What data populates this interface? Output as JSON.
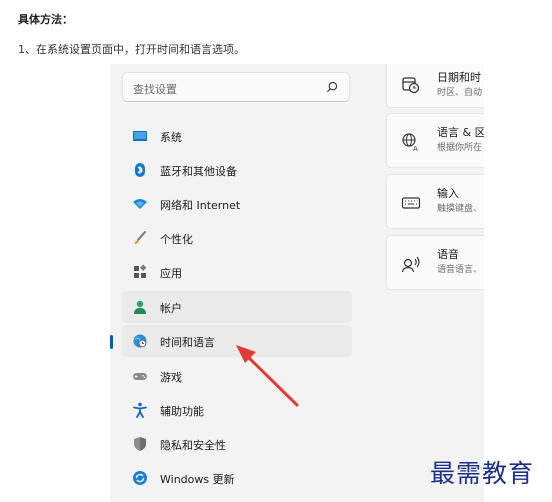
{
  "article": {
    "heading": "具体方法：",
    "step1": "1、在系统设置页面中，打开时间和语言选项。"
  },
  "settings": {
    "search": {
      "placeholder": "查找设置",
      "icon": "search-icon"
    },
    "nav": [
      {
        "label": "系统",
        "icon": "display-icon"
      },
      {
        "label": "蓝牙和其他设备",
        "icon": "bluetooth-icon"
      },
      {
        "label": "网络和 Internet",
        "icon": "wifi-icon"
      },
      {
        "label": "个性化",
        "icon": "brush-icon"
      },
      {
        "label": "应用",
        "icon": "apps-icon"
      },
      {
        "label": "帐户",
        "icon": "account-icon"
      },
      {
        "label": "时间和语言",
        "icon": "globe-clock-icon",
        "selected": true
      },
      {
        "label": "游戏",
        "icon": "gamepad-icon"
      },
      {
        "label": "辅助功能",
        "icon": "accessibility-icon"
      },
      {
        "label": "隐私和安全性",
        "icon": "shield-icon"
      },
      {
        "label": "Windows 更新",
        "icon": "windows-update-icon"
      }
    ],
    "cards": [
      {
        "title": "日期和时",
        "subtitle": "时区、自动",
        "icon": "calendar-clock-icon"
      },
      {
        "title": "语言 & 区",
        "subtitle": "根据你所在",
        "icon": "language-icon"
      },
      {
        "title": "输入",
        "subtitle": "触摸键盘、",
        "icon": "keyboard-icon"
      },
      {
        "title": "语音",
        "subtitle": "语音语言、",
        "icon": "speech-icon"
      }
    ]
  },
  "watermark": "最需教育",
  "colors": {
    "accent": "#005fb8",
    "arrow": "#e53935",
    "watermark": "#1c2f8a"
  }
}
